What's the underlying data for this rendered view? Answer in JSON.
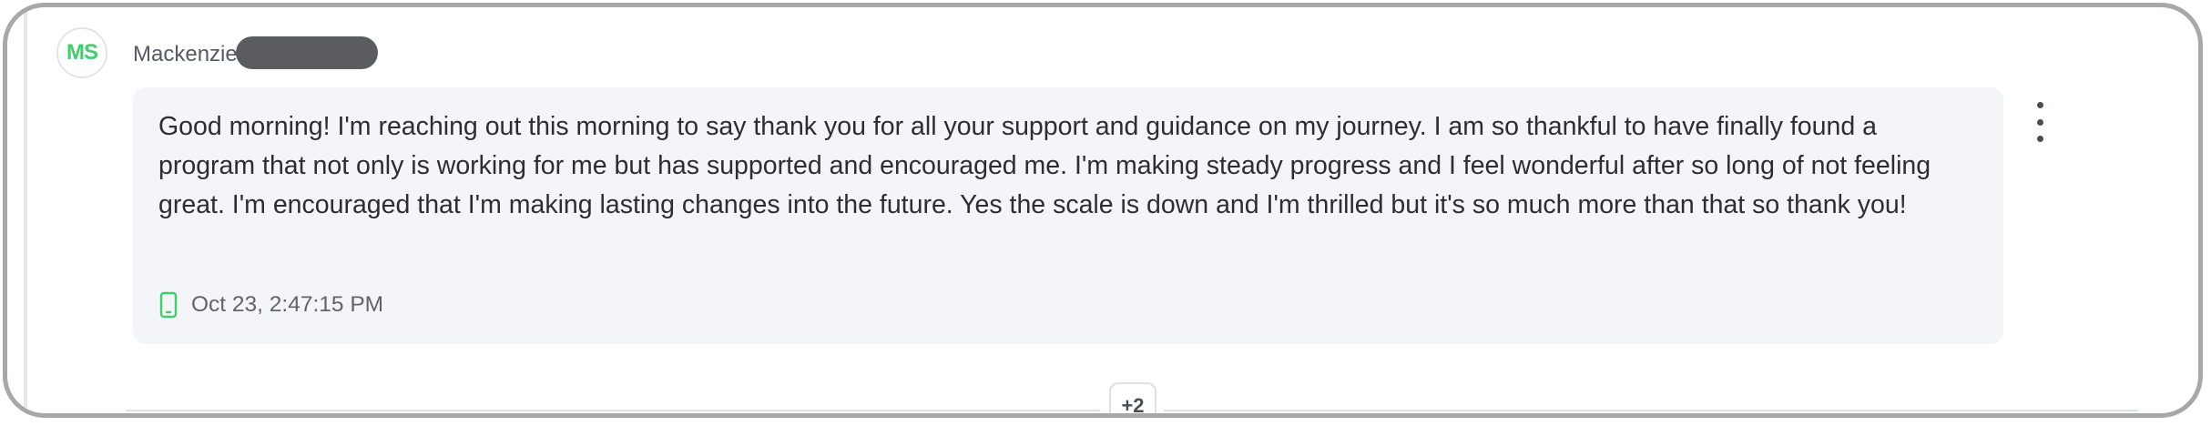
{
  "sender": {
    "initials": "MS",
    "name": "Mackenzie"
  },
  "message": {
    "text": "Good morning! I'm reaching out this morning to say thank you for all your support and guidance on my journey. I am so thankful to have finally found a program that not only is working for me but has supported and encouraged me. I'm making steady progress and I feel wonderful after so long of not feeling great. I'm encouraged that I'm making lasting changes into the future. Yes the scale is down and I'm thrilled but it's so much more than that so thank you!",
    "timestamp": "Oct 23, 2:47:15 PM",
    "source_icon": "mobile-phone-icon"
  },
  "thread": {
    "more_count": "+2"
  },
  "colors": {
    "avatar_initials": "#3fcf6a",
    "bubble_bg": "#f4f5f9",
    "device_icon": "#3fcf6a",
    "redaction": "#5a5c60"
  }
}
